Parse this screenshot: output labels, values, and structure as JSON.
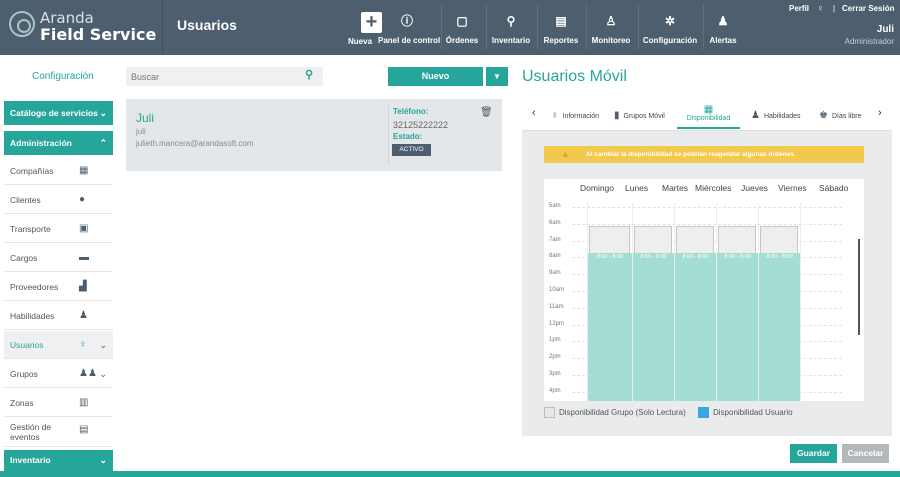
{
  "brand": {
    "line1": "Aranda",
    "line2": "Field Service"
  },
  "header": {
    "module_title": "Usuarios",
    "new_label": "Nueva",
    "nav": [
      {
        "label": "Panel de control",
        "icon": "dashboard-icon"
      },
      {
        "label": "Órdenes",
        "icon": "orders-icon"
      },
      {
        "label": "Inventario",
        "icon": "inventory-icon"
      },
      {
        "label": "Reportes",
        "icon": "reports-icon"
      },
      {
        "label": "Monitoreo",
        "icon": "monitor-icon"
      },
      {
        "label": "Configuración",
        "icon": "gear-icon"
      },
      {
        "label": "Alertas",
        "icon": "bell-icon"
      }
    ],
    "perfil": "Perfil",
    "separator": "|",
    "logout": "Cerrar Sesión",
    "user_name": "Juli",
    "user_role": "Administrador"
  },
  "sidebar": {
    "config_link": "Configuración",
    "catalogo": "Catálogo de servicios",
    "administracion": "Administración",
    "items": [
      {
        "label": "Compañías",
        "icon": "building-icon"
      },
      {
        "label": "Clientes",
        "icon": "person-icon"
      },
      {
        "label": "Transporte",
        "icon": "bus-icon"
      },
      {
        "label": "Cargos",
        "icon": "briefcase-icon"
      },
      {
        "label": "Proveedores",
        "icon": "cart-icon"
      },
      {
        "label": "Habilidades",
        "icon": "skill-icon"
      },
      {
        "label": "Usuarios",
        "icon": "user-icon"
      },
      {
        "label": "Grupos",
        "icon": "group-icon"
      },
      {
        "label": "Zonas",
        "icon": "zone-icon"
      },
      {
        "label": "Gestión de eventos",
        "icon": "events-icon"
      }
    ],
    "inventario": "Inventario"
  },
  "list": {
    "search_placeholder": "Buscar",
    "new_button": "Nuevo",
    "user": {
      "name": "Juli",
      "username": "juli",
      "email": "julieth.mancera@arandasoft.com",
      "phone_label": "Teléfono:",
      "phone": "32125222222",
      "status_label": "Estado:",
      "status": "ACTIVO"
    }
  },
  "panel": {
    "title": "Usuarios Móvil",
    "tabs": {
      "info": "Información",
      "grupos": "Grupos Móvil",
      "disponibilidad": "Disponibilidad",
      "habilidades": "Habilidades",
      "dias_libres": "Días libre"
    },
    "warning": "Al cambiar la disponibilidad se podrían reagendar algunas órdenes.",
    "days": [
      "Domingo",
      "Lunes",
      "Martes",
      "Miércoles",
      "Jueves",
      "Viernes",
      "Sábado"
    ],
    "hours": [
      "5am",
      "6am",
      "7am",
      "8am",
      "9am",
      "10am",
      "11am",
      "12pm",
      "1pm",
      "2pm",
      "3pm",
      "4pm"
    ],
    "availability": [
      {
        "day": "Lunes",
        "group_start": "6am",
        "user_range": "8:00 - 8:00"
      },
      {
        "day": "Martes",
        "group_start": "6am",
        "user_range": "8:00 - 8:00"
      },
      {
        "day": "Miércoles",
        "group_start": "6am",
        "user_range": "8:00 - 8:00"
      },
      {
        "day": "Jueves",
        "group_start": "6am",
        "user_range": "8:00 - 8:00"
      },
      {
        "day": "Viernes",
        "group_start": "6am",
        "user_range": "8:00 - 8:00"
      }
    ],
    "legend_group": "Disponibilidad Grupo (Solo Lectura)",
    "legend_user": "Disponibilidad Usuario",
    "colors": {
      "accent": "#26a69a",
      "user_block": "#a3ddd4",
      "group_block": "#eeeeee",
      "warning": "#f2c94c",
      "header": "#4d5f6f"
    }
  },
  "actions": {
    "save": "Guardar",
    "cancel": "Cancelar"
  }
}
